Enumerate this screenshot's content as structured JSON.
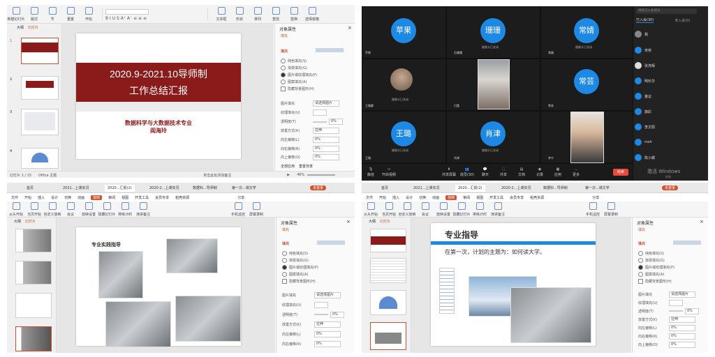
{
  "q1": {
    "ribbon": [
      "新建幻灯片",
      "版式",
      "节",
      "重置",
      "开始",
      "文本框",
      "形状",
      "排列",
      "查找",
      "替换",
      "选择窗格"
    ],
    "panel_tabs": [
      "大纲",
      "幻灯片"
    ],
    "slide_title_line1": "2020.9-2021.10导师制",
    "slide_title_line2": "工作总结汇报",
    "slide_major": "数据科学与大数据技术专业",
    "slide_author": "阎海玲",
    "thumb_labels": [
      "1",
      "2",
      "3",
      "4"
    ],
    "pane_title": "对象属性",
    "pane_sub": "填充",
    "pane_section": "填充",
    "fill_options": [
      "纯色填充(S)",
      "渐变填充(G)",
      "图片或纹理填充(P)",
      "图案填充(A)",
      "隐藏背景图形(H)"
    ],
    "fill_selected": 2,
    "props": [
      {
        "label": "图片填充",
        "value": "请选择图片"
      },
      {
        "label": "纹理填充(U)",
        "value": ""
      },
      {
        "label": "透明度(T)",
        "value": "0%"
      },
      {
        "label": "放置方式(K)",
        "value": "拉伸"
      },
      {
        "label": "向左偏移(L)",
        "value": "0%"
      },
      {
        "label": "向右偏移(R)",
        "value": "0%"
      },
      {
        "label": "向上偏移(O)",
        "value": "0%"
      },
      {
        "label": "向下偏移(M)",
        "value": "0%"
      }
    ],
    "apply_all": "全部应用",
    "reset_bg": "重置背景",
    "status_left": "幻灯片 1 / 15",
    "status_mid": "Office 主题",
    "status_notes": "单击此处添加备注",
    "status_zoom": "46%"
  },
  "q2": {
    "tiles": [
      {
        "name": "苹果",
        "cap": "摄像头已关闭"
      },
      {
        "name": "珊珊",
        "cap": "摄像头已关闭"
      },
      {
        "name": "常婧",
        "cap": "摄像头已关闭"
      },
      {
        "name": "",
        "cap": "摄像头已关闭"
      },
      {
        "name": "",
        "cap": ""
      },
      {
        "name": "常芸",
        "cap": "摄像头已关闭"
      },
      {
        "name": "王璐",
        "cap": "摄像头已关闭"
      },
      {
        "name": "肖津",
        "cap": "摄像头已关闭"
      },
      {
        "name": "",
        "cap": ""
      }
    ],
    "tile_names": [
      "苹果",
      "石珊珊",
      "常婧",
      "王璐静",
      "付喜",
      "常芸",
      "王璐",
      "肖津",
      "李宁"
    ],
    "toolbar": [
      "静音",
      "开启视频",
      "共享屏幕",
      "成员(30)",
      "聊天",
      "共享",
      "文档",
      "记录",
      "应用",
      "更多"
    ],
    "leave": "结束",
    "search_placeholder": "搜索已入会成员",
    "side_tabs": [
      "已入会(30)",
      "未入会(0)"
    ],
    "participants": [
      "我",
      "宋桥",
      "张尧辉",
      "明珍华",
      "童议",
      "旗彩",
      "李文阳",
      "msh",
      "陈小蝶"
    ],
    "watermark_line1": "激活 Windows",
    "watermark_line2": "转到"
  },
  "q3": {
    "tabs": [
      "首页",
      "2021...上课实况",
      "2020...汇报(2)",
      "2020-2...上课实况",
      "数据科...导师制",
      "第一次...课文学"
    ],
    "active_tab": 2,
    "ribbon_tabs": [
      "文件",
      "开始",
      "插入",
      "设计",
      "切换",
      "动画",
      "放映",
      "审阅",
      "视图",
      "开发工具",
      "会员专享",
      "稻壳资源"
    ],
    "active_ribbon": 6,
    "ribbon": [
      "从头开始",
      "当页开始",
      "自定义放映",
      "会议",
      "放映设置",
      "隐藏幻灯片",
      "排练计时",
      "演讲备注",
      "手机遥控",
      "屏幕录制"
    ],
    "panel_tabs": [
      "大纲",
      "幻灯片"
    ],
    "slide_heading": "专业实践指导",
    "pane_title": "对象属性",
    "pane_sub": "填充",
    "pane_section": "填充",
    "fill_options": [
      "纯色填充(S)",
      "渐变填充(G)",
      "图片或纹理填充(P)",
      "图案填充(A)",
      "隐藏背景图形(H)"
    ],
    "fill_selected": 2,
    "props": [
      {
        "label": "图片填充",
        "value": "请选择图片"
      },
      {
        "label": "纹理填充(U)",
        "value": ""
      },
      {
        "label": "透明度(T)",
        "value": "0%"
      },
      {
        "label": "放置方式(K)",
        "value": "拉伸"
      },
      {
        "label": "向左偏移(L)",
        "value": "0%"
      },
      {
        "label": "向右偏移(R)",
        "value": "0%"
      }
    ],
    "sign_in": "未登录",
    "share": "分享"
  },
  "q4": {
    "tabs": [
      "首页",
      "2021...上课实况",
      "2020...汇报(2)",
      "2020-2...上课实况",
      "数据科...导师制",
      "第一次...课文学"
    ],
    "active_tab": 2,
    "ribbon_tabs": [
      "文件",
      "开始",
      "插入",
      "设计",
      "切换",
      "动画",
      "放映",
      "审阅",
      "视图",
      "开发工具",
      "会员专享",
      "稻壳资源"
    ],
    "active_ribbon": 6,
    "ribbon": [
      "从头开始",
      "当页开始",
      "自定义放映",
      "会议",
      "放映设置",
      "隐藏幻灯片",
      "排练计时",
      "演讲备注",
      "手机遥控",
      "屏幕录制"
    ],
    "panel_tabs": [
      "大纲",
      "幻灯片"
    ],
    "slide_heading": "专业指导",
    "slide_line": "在第一次，计划的主题为：如何读大学。",
    "pane_title": "对象属性",
    "pane_sub": "填充",
    "pane_section": "填充",
    "fill_options": [
      "纯色填充(S)",
      "渐变填充(G)",
      "图片或纹理填充(P)",
      "图案填充(A)",
      "隐藏背景图形(H)"
    ],
    "fill_selected": 2,
    "props": [
      {
        "label": "图片填充",
        "value": "请选择图片"
      },
      {
        "label": "纹理填充(U)",
        "value": ""
      },
      {
        "label": "透明度(T)",
        "value": "0%"
      },
      {
        "label": "放置方式(K)",
        "value": "拉伸"
      },
      {
        "label": "向左偏移(L)",
        "value": "0%"
      },
      {
        "label": "向右偏移(R)",
        "value": "0%"
      },
      {
        "label": "向上偏移(O)",
        "value": "0%"
      }
    ],
    "sign_in": "未登录",
    "share": "分享"
  },
  "colors": {
    "accent_red": "#8b1a1a",
    "wps_orange": "#d0512b",
    "meeting_bg": "#1c1c1c",
    "avatar_blue": "#1e88e5",
    "leave_red": "#e84a3c"
  }
}
